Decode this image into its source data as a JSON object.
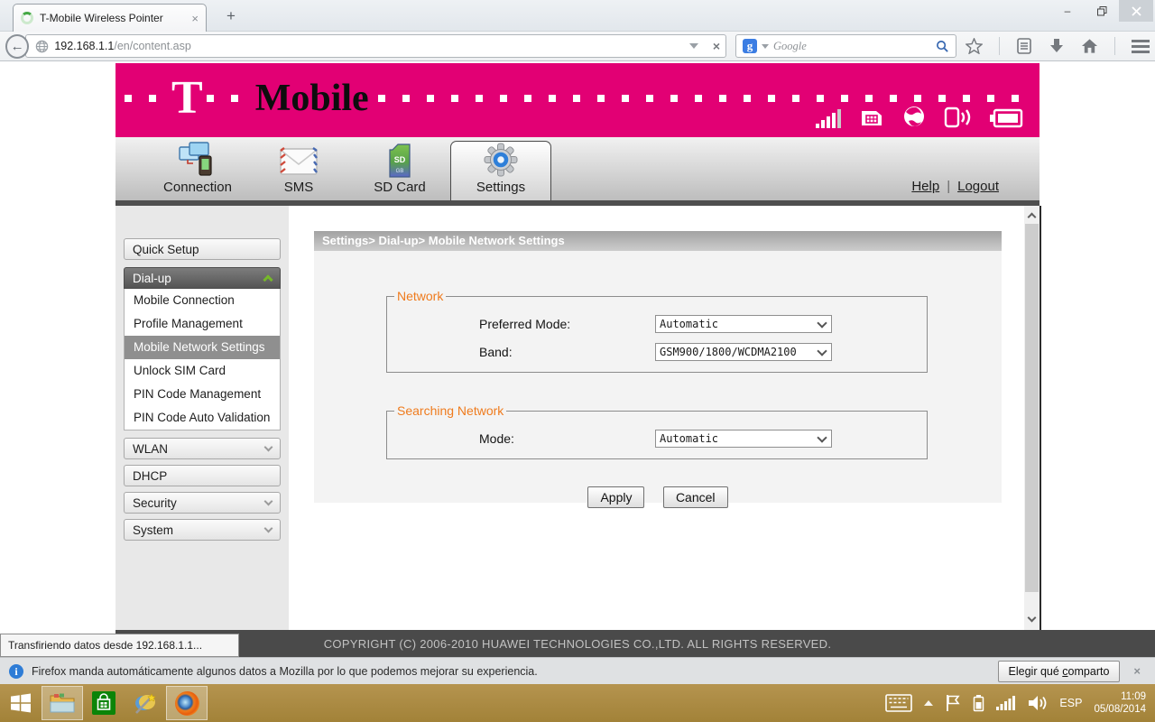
{
  "colors": {
    "brand_magenta": "#e20074",
    "legend_orange": "#ef7b1d",
    "chevron_green": "#76b82a",
    "footer_bg": "#4a4a4a",
    "taskbar_gold": "#ab8a43"
  },
  "icons": {
    "tab_spinner": "green loading ring",
    "url_globe": "globe-outline",
    "search_engine": "google-g-blue-square",
    "window_controls": [
      "minimize",
      "restore",
      "close"
    ],
    "banner_status": [
      "signal-bars",
      "sim-card",
      "globe",
      "device-signal",
      "battery"
    ],
    "nav_tab_icons": [
      "computers-network",
      "envelope",
      "sd-card",
      "gear"
    ],
    "tray": [
      "keyboard",
      "show-hidden",
      "flag",
      "battery",
      "signal",
      "speaker"
    ]
  },
  "browser": {
    "tab_title": "T-Mobile Wireless Pointer",
    "tab_close": "×",
    "new_tab": "+",
    "minimize": "–",
    "url_host": "192.168.1.1",
    "url_path": "/en/content.asp",
    "stop": "×",
    "search_placeholder": "Google",
    "google_g": "g"
  },
  "banner": {
    "logo_t": "T",
    "logo_text": "Mobile"
  },
  "nav": {
    "tabs": [
      {
        "label": "Connection"
      },
      {
        "label": "SMS"
      },
      {
        "label": "SD Card"
      },
      {
        "label": "Settings"
      }
    ],
    "active_tab": "Settings",
    "help": "Help",
    "separator": "|",
    "logout": "Logout"
  },
  "sidebar": {
    "quick_setup": "Quick Setup",
    "dialup": "Dial-up",
    "dialup_items": [
      "Mobile Connection",
      "Profile Management",
      "Mobile Network Settings",
      "Unlock SIM Card",
      "PIN Code Management",
      "PIN Code Auto Validation"
    ],
    "selected_item": "Mobile Network Settings",
    "groups": [
      "WLAN",
      "DHCP",
      "Security",
      "System"
    ]
  },
  "main": {
    "breadcrumb": "Settings> Dial-up> Mobile Network Settings",
    "network": {
      "legend": "Network",
      "preferred_mode_label": "Preferred Mode:",
      "preferred_mode_value": "Automatic",
      "band_label": "Band:",
      "band_value": "GSM900/1800/WCDMA2100"
    },
    "searching": {
      "legend": "Searching Network",
      "mode_label": "Mode:",
      "mode_value": "Automatic"
    },
    "apply": "Apply",
    "cancel": "Cancel"
  },
  "footer": {
    "copyright": "COPYRIGHT (C) 2006-2010 HUAWEI TECHNOLOGIES CO.,LTD. ALL RIGHTS RESERVED."
  },
  "statusbar": {
    "text": "Transfiriendo datos desde 192.168.1.1..."
  },
  "notification": {
    "info": "i",
    "text": "Firefox manda automáticamente algunos datos a Mozilla por lo que podemos mejorar su experiencia.",
    "button_pre": "Elegir qué ",
    "button_key": "c",
    "button_post": "omparto",
    "close": "×"
  },
  "taskbar": {
    "language": "ESP",
    "time": "11:09",
    "date": "05/08/2014"
  }
}
